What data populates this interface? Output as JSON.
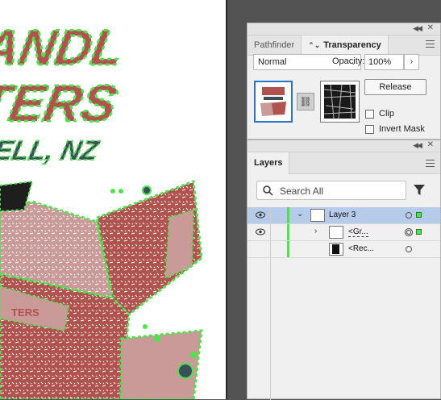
{
  "artwork": {
    "line1": "ANDL",
    "line2": "TERS",
    "line3": "VELL, NZ",
    "badge_text": "TERS"
  },
  "transparency_panel": {
    "tabs": [
      {
        "label": "Pathfinder"
      },
      {
        "label": "Transparency"
      }
    ],
    "blend_mode": "Normal",
    "opacity_label": "Opacity:",
    "opacity_value": "100%",
    "release_button": "Release",
    "clip_label": "Clip",
    "invert_mask_label": "Invert Mask"
  },
  "layers_panel": {
    "tab_label": "Layers",
    "search_placeholder": "Search All",
    "rows": [
      {
        "name": "Layer 3"
      },
      {
        "name": "<Gr..."
      },
      {
        "name": "<Rec..."
      }
    ]
  },
  "colors": {
    "selection_green": "#4de34d",
    "accent_blue": "#2c72c7",
    "selected_row": "#b6cbea",
    "art_red": "#b0534e",
    "art_pink": "#c99a98",
    "art_teal": "#3c4e5b"
  }
}
